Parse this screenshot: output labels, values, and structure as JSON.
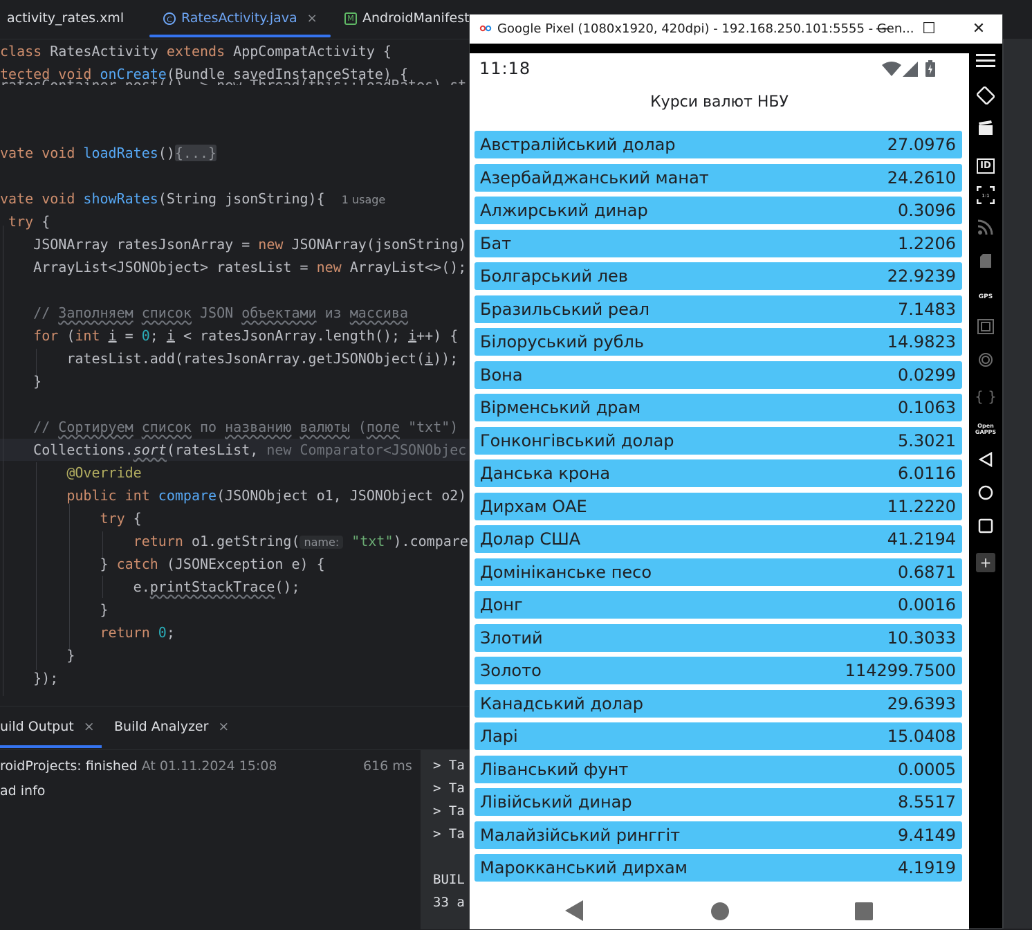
{
  "ide": {
    "tabs": [
      {
        "label": "activity_rates.xml",
        "icon": "xml-file-icon"
      },
      {
        "label": "RatesActivity.java",
        "icon": "java-class-icon",
        "close": "×"
      },
      {
        "label": "AndroidManifest",
        "icon": "manifest-file-icon",
        "letter": "M",
        "close": "×"
      }
    ],
    "code": {
      "l1": {
        "kw1": "class ",
        "name": "RatesActivity ",
        "kw2": "extends ",
        "rest": "AppCompatActivity {"
      },
      "l2": {
        "kw": "tected void ",
        "fn": "onCreate",
        "rest": "(Bundle savedInstanceState) {"
      },
      "l3": {
        "text": "ratesContainer.post(() -> new Thread(this::loadRates).st"
      },
      "l4": {
        "kw": "vate void ",
        "fn": "loadRates",
        "paren": "()",
        "fold": "{...}"
      },
      "l5": {
        "kw": "vate void ",
        "fn": "showRates",
        "rest": "(String jsonString){",
        "hint": "1 usage"
      },
      "l6": {
        "kw": "try",
        "rest": " {"
      },
      "l7": {
        "pre": "JSONArray ratesJsonArray = ",
        "kw": "new",
        "rest": " JSONArray(jsonString)"
      },
      "l8": {
        "pre": "ArrayList<JSONObject> ratesList = ",
        "kw": "new",
        "rest": " ArrayList<>();"
      },
      "l9": {
        "c0": "// ",
        "c1": "Заполняем",
        "c2": " ",
        "c3": "список",
        "c4": " JSON ",
        "c5": "объектами",
        "c6": " из ",
        "c7": "массива"
      },
      "l10": {
        "kw1": "for",
        "a": " (",
        "kw2": "int",
        "b": " ",
        "i1": "i",
        "c": " = ",
        "num": "0",
        "d": "; ",
        "i2": "i",
        "e": " < ratesJsonArray.length(); ",
        "i3": "i",
        "f": "++) {"
      },
      "l11": {
        "a": "ratesList.add(ratesJsonArray.getJSONObject(",
        "i": "i",
        "b": "));"
      },
      "l12": {
        "text": "}"
      },
      "l13": {
        "c0": "// ",
        "c1": "Сортируем",
        "c2": " ",
        "c3": "список",
        "c4": " по ",
        "c5": "названию",
        "c6": " ",
        "c7": "валюты",
        "c8": " (",
        "c9": "поле",
        "c10": " \"txt\")"
      },
      "l14": {
        "a": "Collections.",
        "fn": "sort",
        "b": "(ratesList, ",
        "dim": "new Comparator<JSONObjec"
      },
      "l15": {
        "an": "@Override"
      },
      "l16": {
        "kw1": "public",
        "a": " ",
        "kw2": "int",
        "b": " ",
        "fn": "compare",
        "c": "(JSONObject o1, JSONObject o2)"
      },
      "l17": {
        "kw": "try",
        "rest": " {"
      },
      "l18": {
        "kw": "return",
        "a": " o1.getString(",
        "hint": "name:",
        "str": "\"txt\"",
        "b": ").compare"
      },
      "l19": {
        "a": "} ",
        "kw": "catch",
        "b": " (JSONException e) {"
      },
      "l20": {
        "a": "e.",
        "fn": "printStackTrace",
        "b": "();"
      },
      "l21": {
        "text": "}"
      },
      "l22": {
        "kw": "return",
        "a": " ",
        "num": "0",
        "b": ";"
      },
      "l23": {
        "text": "}"
      },
      "l24": {
        "text": "});"
      }
    },
    "build": {
      "tabs": [
        {
          "label": "uild Output",
          "close": "×"
        },
        {
          "label": "Build Analyzer",
          "close": "×"
        }
      ],
      "row1": {
        "project": "roidProjects:",
        "status": " finished",
        "at": " At 01.11.2024 15:08",
        "duration": "616 ms"
      },
      "row2": {
        "text": "ad info"
      },
      "tasks": [
        "> Ta",
        "> Ta",
        "> Ta",
        "> Ta"
      ],
      "bottom": [
        "BUIL",
        "33 a"
      ]
    }
  },
  "emulator": {
    "title": "Google Pixel (1080x1920, 420dpi) - 192.168.250.101:5555 - Gen...",
    "minimize": "—",
    "maximize": "☐",
    "close": "✕",
    "status": {
      "time": "11:18"
    },
    "app_title": "Курси валют НБУ",
    "rates": [
      {
        "name": "Австралійський долар",
        "value": "27.0976"
      },
      {
        "name": "Азербайджанський манат",
        "value": "24.2610"
      },
      {
        "name": "Алжирський динар",
        "value": "0.3096"
      },
      {
        "name": "Бат",
        "value": "1.2206"
      },
      {
        "name": "Болгарський лев",
        "value": "22.9239"
      },
      {
        "name": "Бразильський реал",
        "value": "7.1483"
      },
      {
        "name": "Білоруський рубль",
        "value": "14.9823"
      },
      {
        "name": "Вона",
        "value": "0.0299"
      },
      {
        "name": "Вірменський драм",
        "value": "0.1063"
      },
      {
        "name": "Гонконгівський долар",
        "value": "5.3021"
      },
      {
        "name": "Данська крона",
        "value": "6.0116"
      },
      {
        "name": "Дирхам ОАЕ",
        "value": "11.2220"
      },
      {
        "name": "Долар США",
        "value": "41.2194"
      },
      {
        "name": "Домініканське песо",
        "value": "0.6871"
      },
      {
        "name": "Донг",
        "value": "0.0016"
      },
      {
        "name": "Злотий",
        "value": "10.3033"
      },
      {
        "name": "Золото",
        "value": "114299.7500"
      },
      {
        "name": "Канадський долар",
        "value": "29.6393"
      },
      {
        "name": "Ларі",
        "value": "15.0408"
      },
      {
        "name": "Ліванський фунт",
        "value": "0.0005"
      },
      {
        "name": "Лівійський динар",
        "value": "8.5517"
      },
      {
        "name": "Малайзійський ринггіт",
        "value": "9.4149"
      },
      {
        "name": "Марокканський дирхам",
        "value": "4.1919"
      }
    ],
    "side_toolbar": [
      {
        "icon": "menu-icon"
      },
      {
        "icon": "rotate-icon"
      },
      {
        "icon": "screencast-icon"
      },
      {
        "icon": "identifiers-icon",
        "label": "ID"
      },
      {
        "icon": "pixel-perfect-icon"
      },
      {
        "icon": "network-icon"
      },
      {
        "icon": "phone-icon"
      },
      {
        "icon": "gps-icon",
        "label": "GPS"
      },
      {
        "icon": "camera-icon"
      },
      {
        "icon": "fingerprint-icon"
      },
      {
        "icon": "api-icon"
      },
      {
        "icon": "open-gapps-icon",
        "label": "Open GAPPS"
      },
      {
        "icon": "back-icon"
      },
      {
        "icon": "home-icon"
      },
      {
        "icon": "overview-icon"
      },
      {
        "icon": "plus-icon"
      }
    ],
    "colors": {
      "row": "#4fc3f7",
      "screen": "#ffffff",
      "text": "#202124"
    }
  }
}
